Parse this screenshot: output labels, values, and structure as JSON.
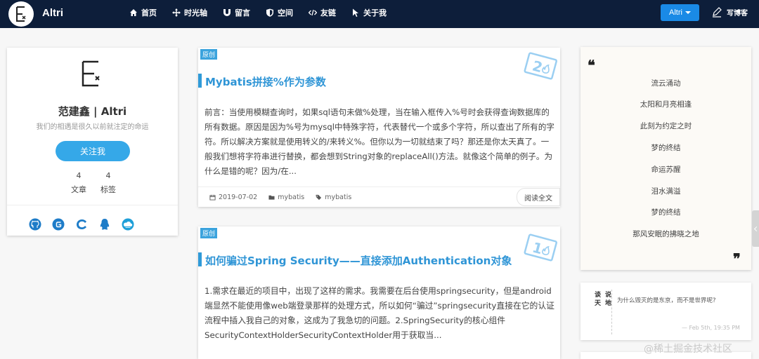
{
  "header": {
    "brand": "Altri",
    "nav": [
      {
        "label": "首页",
        "icon": "home-icon"
      },
      {
        "label": "时光轴",
        "icon": "arrows-move-icon"
      },
      {
        "label": "留言",
        "icon": "magnet-icon"
      },
      {
        "label": "空间",
        "icon": "shield-icon"
      },
      {
        "label": "友链",
        "icon": "code-icon"
      },
      {
        "label": "关于我",
        "icon": "pointer-icon"
      }
    ],
    "user_label": "Altri",
    "write_label": "写博客"
  },
  "profile": {
    "name": "范建鑫 | Altri",
    "motto": "我们的相遇是很久以前就注定的命运",
    "follow_label": "关注我",
    "stats": [
      {
        "value": "4",
        "label": "文章"
      },
      {
        "value": "4",
        "label": "标签"
      }
    ],
    "socials": [
      "github-icon",
      "gitee-icon",
      "csdn-icon",
      "qq-icon",
      "cloud-icon"
    ]
  },
  "articles": [
    {
      "badge": "原创",
      "title": "Mybatis拼接%作为参数",
      "excerpt": "前言：当使用模糊查询时，如果sql语句未做%处理，当在输入框传入%号时会获得查询数据库的所有数据。原因是因为%号为mysql中特殊字符，代表替代一个或多个字符，所以查出了所有的字符。所以解决方案就是使用转义的/来转义%。但你以为一切就结束了吗？那还是你太天真了。一般我们想将字符串进行替换，都会想到String对象的replaceAll()方法。就像这个简单的例子。为什么是错的呢？因为/在...",
      "hot_rank": "2",
      "date": "2019-07-02",
      "category": "mybatis",
      "tag": "mybatis",
      "read_label": "阅读全文"
    },
    {
      "badge": "原创",
      "title": "如何骗过Spring Security——直接添加Authentication对象",
      "excerpt": "1.需求在最近的项目中，出现了这样的需求。我需要在后台使用springsecurity，但是android端显然不能使用像web端登录那样的处理方式，所以如何“骗过”springsecurity直接在它的认证流程中插入我自己的对象，这成为了我急切的问题。2.SpringSecurity的核心组件SecurityContextHolderSecurityContextHolder用于获取当...",
      "hot_rank": "1"
    }
  ],
  "quote": {
    "open_mark": "❝",
    "close_mark": "❞",
    "lines": [
      "流云涌动",
      "太阳和月亮相逢",
      "此刻为约定之时",
      "梦的终结",
      "命运苏醒",
      "泪水满溢",
      "梦的终结",
      "那风安眠的拂晓之地"
    ]
  },
  "dialog": {
    "vertical_cols": [
      "谈天",
      "说地"
    ],
    "text": "为什么毁灭的是东京，而不是世界呢?",
    "time": "— Feb 5th, 19:35 PM"
  },
  "watermark": "@稀土掘金技术社区",
  "colors": {
    "navbar": "#0d1e3a",
    "accent": "#2f95d6",
    "button": "#35a8e8"
  }
}
